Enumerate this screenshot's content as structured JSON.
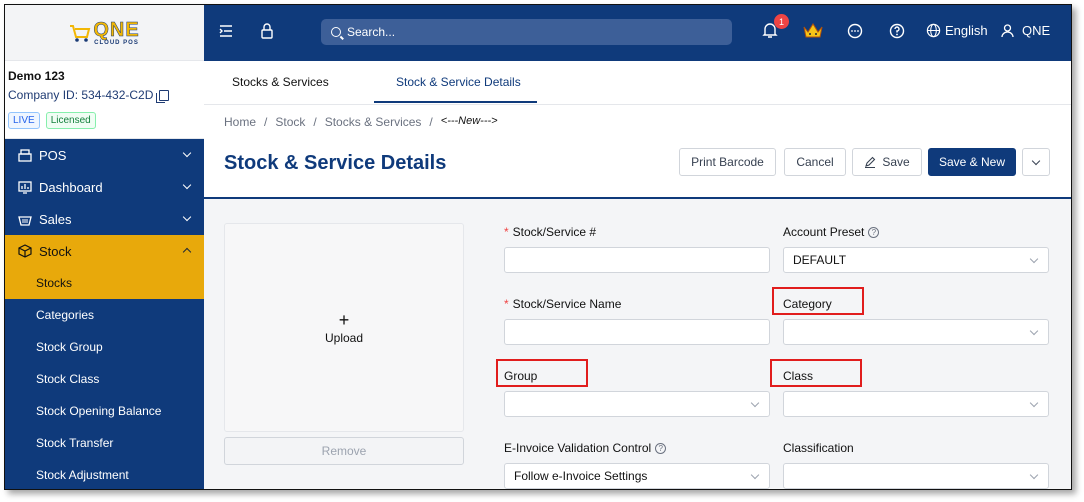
{
  "logo": {
    "brand": "QNE",
    "sub": "CLOUD POS"
  },
  "company": {
    "name": "Demo 123",
    "id": "Company ID: 534-432-C2D",
    "badge_live": "LIVE",
    "badge_licensed": "Licensed"
  },
  "menu": {
    "pos": "POS",
    "dashboard": "Dashboard",
    "sales": "Sales",
    "stock": "Stock",
    "subitems": [
      "Stocks",
      "Categories",
      "Stock Group",
      "Stock Class",
      "Stock Opening Balance",
      "Stock Transfer",
      "Stock Adjustment"
    ]
  },
  "topbar": {
    "search_placeholder": "Search...",
    "notification_count": "1",
    "language": "English",
    "user": "QNE"
  },
  "tabs": [
    "Stocks & Services",
    "Stock & Service Details"
  ],
  "breadcrumb": [
    "Home",
    "/",
    "Stock",
    "/",
    "Stocks & Services",
    "/",
    "<---New--->"
  ],
  "page_title": "Stock & Service Details",
  "buttons": {
    "print": "Print Barcode",
    "cancel": "Cancel",
    "save": "Save",
    "save_new": "Save & New"
  },
  "upload": {
    "label": "Upload",
    "plus": "+",
    "remove": "Remove"
  },
  "form": {
    "stock_no": {
      "label": "Stock/Service #",
      "required": "*",
      "value": ""
    },
    "account_preset": {
      "label": "Account Preset",
      "value": "DEFAULT"
    },
    "stock_name": {
      "label": "Stock/Service Name",
      "required": "*",
      "value": ""
    },
    "category": {
      "label": "Category",
      "value": ""
    },
    "group": {
      "label": "Group",
      "value": ""
    },
    "class": {
      "label": "Class",
      "value": ""
    },
    "einvoice": {
      "label": "E-Invoice Validation Control",
      "value": "Follow e-Invoice Settings"
    },
    "classification": {
      "label": "Classification",
      "value": ""
    }
  },
  "colors": {
    "primary": "#0f3a7b",
    "accent": "#e8a90b",
    "highlight": "#e11d1d"
  }
}
